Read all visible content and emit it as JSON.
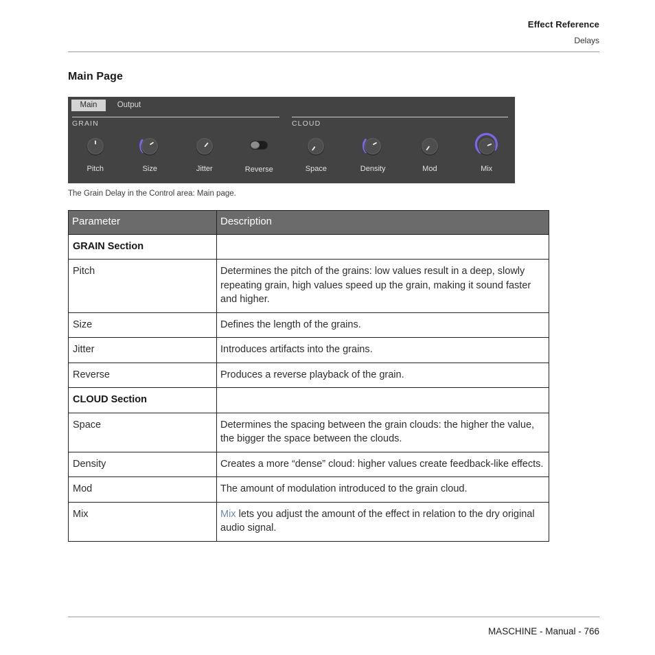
{
  "runhead": {
    "title": "Effect Reference",
    "subtitle": "Delays"
  },
  "heading": "Main Page",
  "plugin": {
    "tabs": [
      {
        "label": "Main",
        "selected": true
      },
      {
        "label": "Output",
        "selected": false
      }
    ],
    "sections": [
      {
        "name": "GRAIN",
        "controls": [
          {
            "label": "Pitch",
            "type": "knob",
            "pointer_deg": 0,
            "arc_deg": 0
          },
          {
            "label": "Size",
            "type": "knob",
            "pointer_deg": 35,
            "arc_deg": 0
          },
          {
            "label": "Jitter",
            "type": "knob",
            "pointer_deg": 30,
            "arc_deg": 0
          },
          {
            "label": "Reverse",
            "type": "toggle",
            "state": "off"
          }
        ]
      },
      {
        "name": "CLOUD",
        "controls": [
          {
            "label": "Space",
            "type": "knob",
            "pointer_deg": -150,
            "arc_deg": 0
          },
          {
            "label": "Density",
            "type": "knob",
            "pointer_deg": 40,
            "arc_deg": 0
          },
          {
            "label": "Mod",
            "type": "knob",
            "pointer_deg": -155,
            "arc_deg": 0
          },
          {
            "label": "Mix",
            "type": "knob",
            "pointer_deg": 55,
            "arc_deg": 0
          }
        ]
      }
    ],
    "accent_color": "#7b66e8",
    "body_color": "#434343"
  },
  "caption": "The Grain Delay in the Control area: Main page.",
  "table": {
    "headers": [
      "Parameter",
      "Description"
    ],
    "rows": [
      {
        "kind": "section",
        "parameter": "GRAIN Section",
        "description": ""
      },
      {
        "kind": "param",
        "parameter": "Pitch",
        "description": "Determines the pitch of the grains: low values result in a deep, slowly repeating grain, high values speed up the grain, making it sound faster and higher."
      },
      {
        "kind": "param",
        "parameter": "Size",
        "description": "Defines the length of the grains."
      },
      {
        "kind": "param",
        "parameter": "Jitter",
        "description": "Introduces artifacts into the grains."
      },
      {
        "kind": "param",
        "parameter": "Reverse",
        "description": "Produces a reverse playback of the grain."
      },
      {
        "kind": "section",
        "parameter": "CLOUD Section",
        "description": ""
      },
      {
        "kind": "param",
        "parameter": "Space",
        "description": "Determines the spacing between the grain clouds: the higher the value, the bigger the space between the clouds."
      },
      {
        "kind": "param",
        "parameter": "Density",
        "description": "Creates a more “dense” cloud: higher values create feedback-like effects."
      },
      {
        "kind": "param",
        "parameter": "Mod",
        "description": "The amount of modulation introduced to the grain cloud."
      },
      {
        "kind": "param",
        "parameter": "Mix",
        "description_link": "Mix",
        "description": " lets you adjust the amount of the effect in relation to the dry original audio signal."
      }
    ],
    "link_color": "#7189ab",
    "header_bg": "#6b6b6b"
  },
  "footer": "MASCHINE - Manual - 766"
}
